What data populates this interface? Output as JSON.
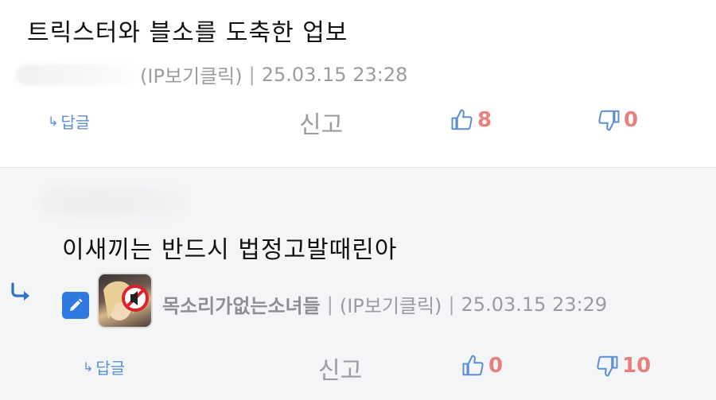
{
  "comments": [
    {
      "text": "트릭스터와 블소를 도축한 업보",
      "ip_label": "(IP보기클릭)",
      "separator": "|",
      "datetime": "25.03.15 23:28",
      "reply_label": "답글",
      "report_label": "신고",
      "likes": "8",
      "dislikes": "0"
    },
    {
      "text": "이새끼는 반드시 법정고발때린아",
      "nickname": "목소리가없는소녀들",
      "ip_label": "(IP보기클릭)",
      "separator": "|",
      "datetime": "25.03.15 23:29",
      "reply_label": "답글",
      "report_label": "신고",
      "likes": "0",
      "dislikes": "10"
    }
  ],
  "icons": {
    "reply_arrow": "reply-arrow-icon",
    "edit": "pencil-icon",
    "thumbs_up": "thumbs-up-icon",
    "thumbs_down": "thumbs-down-icon"
  },
  "colors": {
    "accent_blue": "#5b8ed6",
    "vote_count": "#e8807d",
    "reply_bg": "#f4f5f7"
  }
}
